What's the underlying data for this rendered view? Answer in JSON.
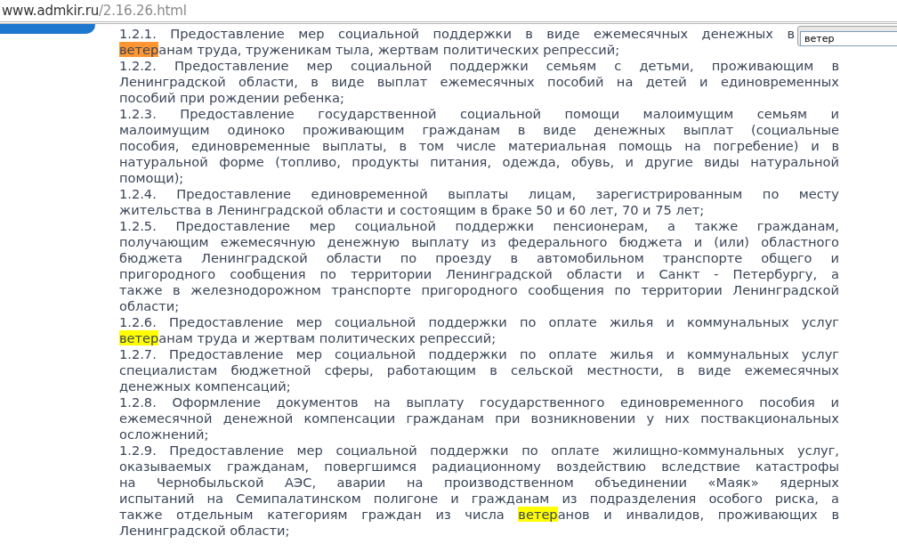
{
  "address_bar": {
    "domain": "www.admkir.ru",
    "path": "/2.16.26.html"
  },
  "find_field": {
    "value": "ветер"
  },
  "items": [
    {
      "lines": [
        "1.2.1. Предоставление мер социальной поддержки в виде ежемесячных денежных в",
        [
          {
            "text": "ветер",
            "color": "#ff9632"
          },
          {
            "text": "анам труда, труженикам тыла, жертвам политических репрессий;"
          }
        ]
      ]
    },
    {
      "lines": [
        "1.2.2. Предоставление мер социальной поддержки семьям с детьми, проживающим в",
        "Ленинградской области, в виде выплат ежемесячных пособий на детей и единовременных",
        "пособий при рождении ребенка;"
      ]
    },
    {
      "lines": [
        "1.2.3. Предоставление государственной социальной помощи малоимущим семьям и",
        "малоимущим одиноко проживающим гражданам в виде денежных выплат (социальные",
        "пособия, единовременные выплаты, в том числе материальная помощь на погребение) и в",
        "натуральной форме (топливо, продукты питания, одежда, обувь, и другие виды натуральной",
        "помощи);"
      ]
    },
    {
      "lines": [
        "1.2.4. Предоставление единовременной выплаты лицам, зарегистрированным по месту",
        "жительства в Ленинградской области и состоящим в браке 50 и 60 лет, 70 и 75 лет;"
      ]
    },
    {
      "lines": [
        "1.2.5. Предоставление мер социальной поддержки пенсионерам, а также гражданам,",
        "получающим ежемесячную денежную выплату из федерального бюджета и (или) областного",
        "бюджета Ленинградской области по проезду в автомобильном транспорте общего и",
        "пригородного сообщения по территории Ленинградской области и Санкт - Петербургу, а",
        "также в железнодорожном транспорте пригородного сообщения по территории Ленинградской",
        "области;"
      ]
    },
    {
      "lines": [
        "1.2.6. Предоставление мер социальной поддержки по оплате жилья и коммунальных услуг",
        [
          {
            "text": "ветер",
            "color": "#ffff00"
          },
          {
            "text": "анам труда и жертвам политических репрессий;"
          }
        ]
      ]
    },
    {
      "lines": [
        "1.2.7. Предоставление мер социальной поддержки по оплате жилья и коммунальных услуг",
        "специалистам бюджетной сферы, работающим в сельской местности, в виде ежемесячных",
        "денежных компенсаций;"
      ]
    },
    {
      "lines": [
        "1.2.8. Оформление документов на выплату государственного единовременного пособия и",
        "ежемесячной денежной компенсации гражданам при возникновении у них поствакциональных",
        "осложнений;"
      ]
    },
    {
      "lines": [
        "1.2.9. Предоставление мер социальной поддержки по оплате жилищно-коммунальных услуг,",
        "оказываемых гражданам, повергшимся радиационному воздействию вследствие катастрофы",
        "на Чернобыльской АЭС, аварии на производственном объединении «Маяк» ядерных",
        "испытаний на Семипалатинском полигоне и гражданам из подразделения особого риска, а",
        [
          {
            "text": "также отдельным категориям граждан из числа "
          },
          {
            "text": "ветер",
            "color": "#ffff00"
          },
          {
            "text": "анов и инвалидов, проживающих в"
          }
        ],
        "Ленинградской области;"
      ]
    }
  ]
}
